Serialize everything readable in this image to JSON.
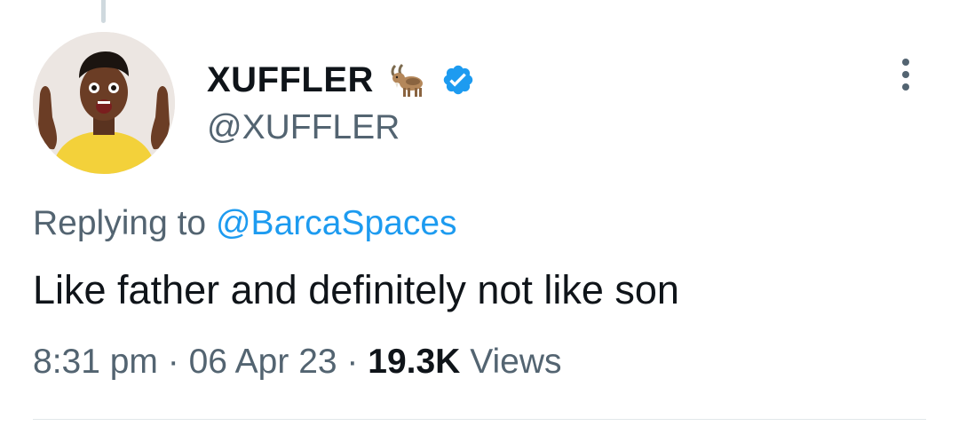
{
  "tweet": {
    "author": {
      "display_name": "XUFFLER",
      "name_emoji_icon": "goat-emoji-icon",
      "verified_icon": "verified-badge-icon",
      "handle": "@XUFFLER"
    },
    "replying_to": {
      "prefix": "Replying to",
      "mention": "@BarcaSpaces"
    },
    "text": "Like father and definitely not like son",
    "meta": {
      "time": "8:31 pm",
      "separator": "·",
      "date": "06 Apr 23",
      "views_count": "19.3K",
      "views_label": "Views"
    },
    "more_icon": "more-options-icon"
  },
  "colors": {
    "text_primary": "#0f1419",
    "text_secondary": "#536471",
    "accent": "#1d9bf0",
    "divider": "#e2e7ea"
  }
}
